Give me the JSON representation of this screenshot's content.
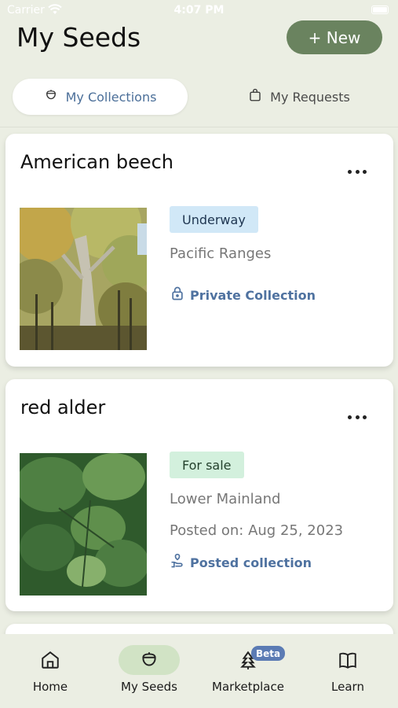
{
  "status_bar": {
    "carrier": "Carrier",
    "time": "4:07 PM"
  },
  "header": {
    "title": "My Seeds",
    "new_button": "+ New"
  },
  "tabs": [
    {
      "label": "My Collections",
      "icon": "acorn-icon",
      "selected": true
    },
    {
      "label": "My Requests",
      "icon": "shopping-bag-icon",
      "selected": false
    }
  ],
  "collections": [
    {
      "name": "American beech",
      "status": "Underway",
      "region": "Pacific Ranges",
      "link_label": "Private Collection",
      "link_icon": "lock-icon"
    },
    {
      "name": "red alder",
      "status": "For sale",
      "region": "Lower Mainland",
      "posted_on": "Posted on: Aug 25, 2023",
      "link_label": "Posted collection",
      "link_icon": "hand-holding-icon"
    }
  ],
  "bottom_nav": [
    {
      "label": "Home",
      "icon": "home-icon",
      "active": false
    },
    {
      "label": "My Seeds",
      "icon": "acorn-icon",
      "active": true
    },
    {
      "label": "Marketplace",
      "icon": "tree-icon",
      "active": false,
      "badge": "Beta"
    },
    {
      "label": "Learn",
      "icon": "open-book-icon",
      "active": false
    }
  ],
  "colors": {
    "background": "#ebeee3",
    "new_button": "#6a835f",
    "link_blue": "#4f72a0",
    "underway_badge": "#d1e8f7",
    "forsale_badge": "#d3f0dd",
    "nav_active": "#d1e3c5",
    "beta_badge": "#5b7bb4"
  }
}
